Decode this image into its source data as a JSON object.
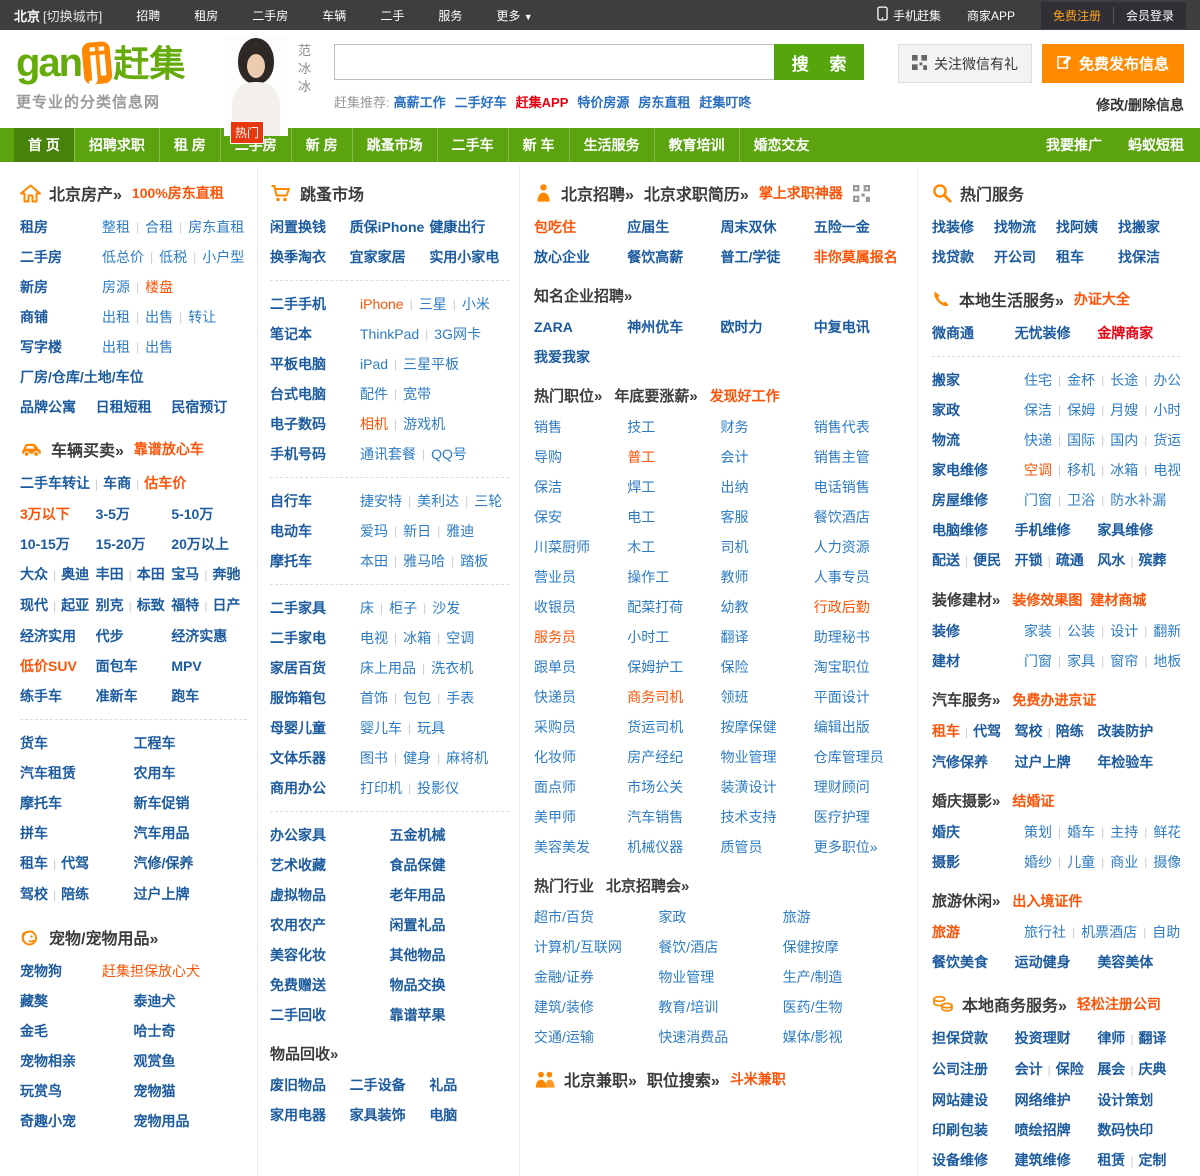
{
  "topbar": {
    "city": "北京",
    "switch_city": "[切换城市]",
    "links": [
      "招聘",
      "租房",
      "二手房",
      "车辆",
      "二手",
      "服务"
    ],
    "more": "更多",
    "right": {
      "mobile": "手机赶集",
      "merchant_app": "商家APP",
      "register": "免费注册",
      "login": "会员登录"
    }
  },
  "header": {
    "logo_gan": "gan",
    "logo_ji": "ji",
    "logo_cn": "赶集",
    "tagline": "更专业的分类信息网",
    "celebrity": "范冰冰",
    "hot_tag": "热门",
    "search_button": "搜 索",
    "recommend_label": "赶集推荐:",
    "recommend_links": [
      "高薪工作",
      "二手好车",
      {
        "t": "赶集APP",
        "c": "r"
      },
      "特价房源",
      "房东直租",
      "赶集叮咚"
    ],
    "wechat": "关注微信有礼",
    "post_button": "免费发布信息",
    "modify": "修改/删除信息"
  },
  "nav": {
    "items": [
      {
        "label": "首 页",
        "active": true
      },
      {
        "label": "招聘求职"
      },
      {
        "label": "租 房"
      },
      {
        "label": "二手房"
      },
      {
        "label": "新 房"
      },
      {
        "label": "跳蚤市场"
      },
      {
        "label": "二手车"
      },
      {
        "label": "新 车"
      },
      {
        "label": "生活服务"
      },
      {
        "label": "教育培训"
      },
      {
        "label": "婚恋交友"
      }
    ],
    "right": [
      "我要推广",
      "蚂蚁短租"
    ]
  },
  "colors": {
    "accent_orange": "#ff5407",
    "brand_green": "#5ca40f",
    "link_blue": "#2e7cc3",
    "label_navy": "#1c5b9e",
    "alert_red": "#e60012"
  },
  "cols": [
    {
      "blocks": [
        {
          "t": "h",
          "icon": "house-icon",
          "titles": [
            "北京房产»"
          ],
          "extras": [
            {
              "t": "100%房东直租",
              "c": "o"
            }
          ]
        },
        {
          "t": "r",
          "label": "租房",
          "links": [
            "整租",
            "合租",
            "房东直租"
          ]
        },
        {
          "t": "r",
          "label": "二手房",
          "links": [
            "低总价",
            "低税",
            "小户型"
          ]
        },
        {
          "t": "r",
          "label": "新房",
          "links": [
            "房源",
            {
              "t": "楼盘",
              "c": "o"
            }
          ]
        },
        {
          "t": "r",
          "label": "商铺",
          "links": [
            "出租",
            "出售",
            "转让"
          ]
        },
        {
          "t": "r",
          "label": "写字楼",
          "links": [
            "出租",
            "出售"
          ]
        },
        {
          "t": "g",
          "cols": 1,
          "strong": true,
          "items": [
            "厂房/仓库/土地/车位"
          ]
        },
        {
          "t": "g",
          "cols": 3,
          "strong": true,
          "items": [
            "品牌公寓",
            "日租短租",
            "民宿预订"
          ]
        },
        {
          "t": "h",
          "icon": "car-icon",
          "titles": [
            "车辆买卖»"
          ],
          "extras": [
            {
              "t": "靠谱放心车",
              "c": "o"
            }
          ]
        },
        {
          "t": "g",
          "cols": 1,
          "strong": true,
          "items": [
            [
              "二手车转让",
              "车商",
              {
                "t": "估车价",
                "c": "o"
              }
            ]
          ]
        },
        {
          "t": "g",
          "cols": 3,
          "strong": true,
          "items": [
            {
              "t": "3万以下",
              "c": "o"
            },
            "3-5万",
            "5-10万",
            "10-15万",
            "15-20万",
            "20万以上"
          ]
        },
        {
          "t": "g",
          "cols": 3,
          "strong": true,
          "items": [
            [
              "大众",
              "奥迪"
            ],
            [
              "丰田",
              "本田"
            ],
            [
              "宝马",
              "奔驰"
            ],
            [
              "现代",
              "起亚"
            ],
            [
              "别克",
              "标致"
            ],
            [
              "福特",
              "日产"
            ]
          ]
        },
        {
          "t": "g",
          "cols": 3,
          "strong": true,
          "items": [
            "经济实用",
            "代步",
            "经济实惠",
            {
              "t": "低价SUV",
              "c": "o"
            },
            "面包车",
            "MPV",
            "练手车",
            "准新车",
            "跑车"
          ]
        },
        {
          "t": "d"
        },
        {
          "t": "g",
          "cols": 2,
          "strong": true,
          "items": [
            "货车",
            "工程车",
            "汽车租赁",
            "农用车",
            "摩托车",
            "新车促销",
            "拼车",
            "汽车用品",
            [
              "租车",
              "代驾"
            ],
            "汽修/保养",
            [
              "驾校",
              "陪练"
            ],
            "过户上牌"
          ]
        },
        {
          "t": "h",
          "icon": "dog-icon",
          "titles": [
            "宠物/宠物用品»"
          ]
        },
        {
          "t": "r",
          "label": "宠物狗",
          "links": [
            {
              "t": "赶集担保放心犬",
              "c": "o"
            }
          ]
        },
        {
          "t": "g",
          "cols": 2,
          "strong": true,
          "items": [
            "藏獒",
            "泰迪犬",
            "金毛",
            "哈士奇",
            "宠物相亲",
            "观赏鱼",
            "玩赏鸟",
            "宠物猫",
            "奇趣小宠",
            "宠物用品"
          ]
        }
      ]
    },
    {
      "blocks": [
        {
          "t": "h",
          "icon": "cart-icon",
          "titles": [
            "跳蚤市场"
          ]
        },
        {
          "t": "g",
          "cols": 3,
          "strong": true,
          "items": [
            "闲置换钱",
            "质保iPhone",
            "健康出行",
            "换季淘衣",
            "宜家家居",
            "实用小家电"
          ]
        },
        {
          "t": "d"
        },
        {
          "t": "r",
          "label": "二手手机",
          "links": [
            {
              "t": "iPhone",
              "c": "o"
            },
            "三星",
            "小米"
          ]
        },
        {
          "t": "r",
          "label": "笔记本",
          "links": [
            "ThinkPad",
            "3G网卡"
          ]
        },
        {
          "t": "r",
          "label": "平板电脑",
          "links": [
            "iPad",
            "三星平板"
          ]
        },
        {
          "t": "r",
          "label": "台式电脑",
          "links": [
            "配件",
            "宽带"
          ]
        },
        {
          "t": "r",
          "label": "电子数码",
          "links": [
            {
              "t": "相机",
              "c": "o"
            },
            "游戏机"
          ]
        },
        {
          "t": "r",
          "label": "手机号码",
          "links": [
            "通讯套餐",
            "QQ号"
          ]
        },
        {
          "t": "d"
        },
        {
          "t": "r",
          "label": "自行车",
          "links": [
            "捷安特",
            "美利达",
            "三轮"
          ]
        },
        {
          "t": "r",
          "label": "电动车",
          "links": [
            "爱玛",
            "新日",
            "雅迪"
          ]
        },
        {
          "t": "r",
          "label": "摩托车",
          "links": [
            "本田",
            "雅马哈",
            "踏板"
          ]
        },
        {
          "t": "d"
        },
        {
          "t": "r",
          "label": "二手家具",
          "links": [
            "床",
            "柜子",
            "沙发"
          ]
        },
        {
          "t": "r",
          "label": "二手家电",
          "links": [
            "电视",
            "冰箱",
            "空调"
          ]
        },
        {
          "t": "r",
          "label": "家居百货",
          "links": [
            "床上用品",
            "洗衣机"
          ]
        },
        {
          "t": "r",
          "label": "服饰箱包",
          "links": [
            "首饰",
            "包包",
            "手表"
          ]
        },
        {
          "t": "r",
          "label": "母婴儿童",
          "links": [
            "婴儿车",
            "玩具"
          ]
        },
        {
          "t": "r",
          "label": "文体乐器",
          "links": [
            "图书",
            "健身",
            "麻将机"
          ]
        },
        {
          "t": "r",
          "label": "商用办公",
          "links": [
            "打印机",
            "投影仪"
          ]
        },
        {
          "t": "d"
        },
        {
          "t": "g",
          "cols": 2,
          "strong": true,
          "items": [
            "办公家具",
            "五金机械",
            "艺术收藏",
            "食品保健",
            "虚拟物品",
            "老年用品",
            "农用农产",
            "闲置礼品",
            "美容化妆",
            "其他物品",
            "免费赠送",
            "物品交换",
            "二手回收",
            "靠谱苹果"
          ]
        },
        {
          "t": "s",
          "titles": [
            "物品回收»"
          ]
        },
        {
          "t": "g",
          "cols": 3,
          "strong": true,
          "items": [
            "废旧物品",
            "二手设备",
            "礼品",
            "家用电器",
            "家具装饰",
            "电脑"
          ]
        }
      ]
    },
    {
      "blocks": [
        {
          "t": "h",
          "icon": "job-icon",
          "titles": [
            "北京招聘»",
            "北京求职简历»"
          ],
          "extras": [
            {
              "t": "掌上求职神器",
              "c": "o"
            }
          ],
          "qr": true
        },
        {
          "t": "g",
          "cols": 4,
          "strong": true,
          "items": [
            {
              "t": "包吃住",
              "c": "o"
            },
            "应届生",
            "周末双休",
            "五险一金",
            "放心企业",
            "餐饮高薪",
            "普工/学徒",
            {
              "t": "非你莫属报名",
              "c": "o"
            }
          ]
        },
        {
          "t": "s",
          "titles": [
            "知名企业招聘»"
          ]
        },
        {
          "t": "g",
          "cols": 4,
          "strong": true,
          "items": [
            "ZARA",
            "神州优车",
            "欧时力",
            "中复电讯",
            "我爱我家"
          ]
        },
        {
          "t": "s",
          "titles": [
            "热门职位»",
            "年底要涨薪»"
          ],
          "extras": [
            {
              "t": "发现好工作",
              "c": "o"
            }
          ]
        },
        {
          "t": "g",
          "cols": 4,
          "strong": false,
          "items": [
            "销售",
            "技工",
            "财务",
            "销售代表",
            "导购",
            {
              "t": "普工",
              "c": "o"
            },
            "会计",
            "销售主管",
            "保洁",
            "焊工",
            "出纳",
            "电话销售",
            "保安",
            "电工",
            "客服",
            "餐饮酒店",
            "川菜厨师",
            "木工",
            "司机",
            "人力资源",
            "营业员",
            "操作工",
            "教师",
            "人事专员",
            "收银员",
            "配菜打荷",
            "幼教",
            {
              "t": "行政后勤",
              "c": "o"
            },
            {
              "t": "服务员",
              "c": "o"
            },
            "小时工",
            "翻译",
            "助理秘书",
            "跟单员",
            "保姆护工",
            "保险",
            "淘宝职位",
            "快递员",
            {
              "t": "商务司机",
              "c": "o"
            },
            "领班",
            "平面设计",
            "采购员",
            "货运司机",
            "按摩保健",
            "编辑出版",
            "化妆师",
            "房产经纪",
            "物业管理",
            "仓库管理员",
            "面点师",
            "市场公关",
            "装潢设计",
            "理财顾问",
            "美甲师",
            "汽车销售",
            "技术支持",
            "医疗护理",
            "美容美发",
            "机械仪器",
            "质管员",
            "更多职位»"
          ]
        },
        {
          "t": "s",
          "titles": [
            "热门行业",
            "北京招聘会»"
          ]
        },
        {
          "t": "g",
          "cols": 3,
          "strong": false,
          "items": [
            "超市/百货",
            "家政",
            "旅游",
            "计算机/互联网",
            "餐饮/酒店",
            "保健按摩",
            "金融/证券",
            "物业管理",
            "生产/制造",
            "建筑/装修",
            "教育/培训",
            "医药/生物",
            "交通/运输",
            "快速消费品",
            "媒体/影视"
          ]
        },
        {
          "t": "h",
          "icon": "people-icon",
          "titles": [
            "北京兼职»",
            "职位搜索»"
          ],
          "extras": [
            {
              "t": "斗米兼职",
              "c": "o"
            }
          ]
        }
      ]
    },
    {
      "blocks": [
        {
          "t": "h",
          "icon": "search-icon",
          "titles": [
            "热门服务"
          ]
        },
        {
          "t": "g",
          "cols": 4,
          "strong": true,
          "items": [
            "找装修",
            "找物流",
            "找阿姨",
            "找搬家",
            "找贷款",
            "开公司",
            "租车",
            "找保洁"
          ]
        },
        {
          "t": "h",
          "icon": "phone-icon",
          "titles": [
            "本地生活服务»"
          ],
          "extras": [
            {
              "t": "办证大全",
              "c": "o"
            }
          ]
        },
        {
          "t": "g",
          "cols": 3,
          "strong": true,
          "items": [
            "微商通",
            "无忧装修",
            {
              "t": "金牌商家",
              "c": "r"
            }
          ]
        },
        {
          "t": "d"
        },
        {
          "t": "r",
          "label": "搬家",
          "links": [
            "住宅",
            "金杯",
            "长途",
            "办公室"
          ]
        },
        {
          "t": "r",
          "label": "家政",
          "links": [
            "保洁",
            "保姆",
            "月嫂",
            "小时工"
          ]
        },
        {
          "t": "r",
          "label": "物流",
          "links": [
            "快递",
            "国际",
            "国内",
            "货运"
          ]
        },
        {
          "t": "r",
          "label": "家电维修",
          "links": [
            {
              "t": "空调",
              "c": "o"
            },
            "移机",
            "冰箱",
            "电视"
          ]
        },
        {
          "t": "r",
          "label": "房屋维修",
          "links": [
            "门窗",
            "卫浴",
            "防水补漏"
          ]
        },
        {
          "t": "g",
          "cols": 3,
          "strong": true,
          "items": [
            "电脑维修",
            "手机维修",
            "家具维修"
          ]
        },
        {
          "t": "g",
          "cols": 3,
          "strong": true,
          "items": [
            [
              "配送",
              "便民"
            ],
            [
              "开锁",
              "疏通"
            ],
            [
              "风水",
              "殡葬"
            ]
          ]
        },
        {
          "t": "s",
          "titles": [
            "装修建材»"
          ],
          "extras": [
            {
              "t": "装修效果图",
              "c": "o"
            },
            {
              "t": "建材商城",
              "c": "o"
            }
          ]
        },
        {
          "t": "r",
          "label": "装修",
          "links": [
            "家装",
            "公装",
            "设计",
            "翻新"
          ]
        },
        {
          "t": "r",
          "label": "建材",
          "links": [
            "门窗",
            "家具",
            "窗帘",
            "地板"
          ]
        },
        {
          "t": "s",
          "titles": [
            "汽车服务»"
          ],
          "extras": [
            {
              "t": "免费办进京证",
              "c": "o"
            }
          ]
        },
        {
          "t": "g",
          "cols": 3,
          "strong": true,
          "items": [
            [
              {
                "t": "租车",
                "c": "o"
              },
              "代驾"
            ],
            [
              "驾校",
              "陪练"
            ],
            "改装防护",
            "汽修保养",
            "过户上牌",
            "年检验车"
          ]
        },
        {
          "t": "s",
          "titles": [
            "婚庆摄影»"
          ],
          "extras": [
            {
              "t": "结婚证",
              "c": "o"
            }
          ]
        },
        {
          "t": "r",
          "label": "婚庆",
          "links": [
            "策划",
            "婚车",
            "主持",
            "鲜花"
          ]
        },
        {
          "t": "r",
          "label": "摄影",
          "links": [
            "婚纱",
            "儿童",
            "商业",
            "摄像"
          ]
        },
        {
          "t": "s",
          "titles": [
            "旅游休闲»"
          ],
          "extras": [
            {
              "t": "出入境证件",
              "c": "o"
            }
          ]
        },
        {
          "t": "r",
          "label": {
            "t": "旅游",
            "c": "o"
          },
          "links": [
            "旅行社",
            "机票酒店",
            "自助游"
          ]
        },
        {
          "t": "g",
          "cols": 3,
          "strong": true,
          "items": [
            "餐饮美食",
            "运动健身",
            "美容美体"
          ]
        },
        {
          "t": "h",
          "icon": "coins-icon",
          "titles": [
            "本地商务服务»"
          ],
          "extras": [
            {
              "t": "轻松注册公司",
              "c": "o"
            }
          ]
        },
        {
          "t": "g",
          "cols": 3,
          "strong": true,
          "items": [
            "担保贷款",
            "投资理财",
            [
              "律师",
              "翻译"
            ],
            "公司注册",
            [
              "会计",
              "保险"
            ],
            [
              "展会",
              "庆典"
            ],
            "网站建设",
            "网络维护",
            "设计策划",
            "印刷包装",
            "喷绘招牌",
            "数码快印",
            "设备维修",
            "建筑维修",
            [
              "租赁",
              "定制"
            ]
          ]
        }
      ]
    }
  ]
}
